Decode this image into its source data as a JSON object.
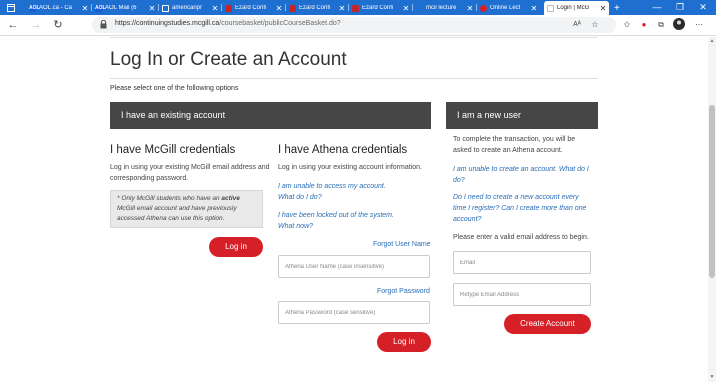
{
  "browser": {
    "tabs": [
      {
        "label": "AOL.ca - Ca",
        "fav_color": "#1d5bd6",
        "fav_text": "AOL"
      },
      {
        "label": "AOL Mail (6",
        "fav_color": "#1d5bd6",
        "fav_text": "AOL"
      },
      {
        "label": "americanpr",
        "fav_color": "#333333",
        "fav_text": ""
      },
      {
        "label": "Ezard Confi",
        "fav_color": "#c1272d",
        "fav_text": ""
      },
      {
        "label": "Ezard Confi",
        "fav_color": "#c1272d",
        "fav_text": ""
      },
      {
        "label": "Ezard Confi",
        "fav_color": "#c1272d",
        "fav_text": ""
      },
      {
        "label": "mcil lecture",
        "fav_color": "#1f6fd1",
        "fav_text": ""
      },
      {
        "label": "Online Lect",
        "fav_color": "#d62027",
        "fav_text": ""
      },
      {
        "label": "Login | McG",
        "fav_color": "#dddddd",
        "fav_text": ""
      }
    ],
    "new_tab": "+",
    "url_host": "https://continuingstudies.mcgill.ca",
    "url_path": "/coursebasket/publicCourseBasket.do?"
  },
  "page": {
    "title": "Log In or Create an Account",
    "subtitle": "Please select one of the following options",
    "existing_bar": "I have an existing account",
    "new_bar": "I am a new user",
    "mcgill": {
      "heading": "I have McGill credentials",
      "desc": "Log in using your existing McGill email address and corresponding password.",
      "note_pre": "* Only McGill students who have an ",
      "note_bold": "active",
      "note_post": " McGill email account and have previously accessed Athena can use this option.",
      "login_label": "Log in"
    },
    "athena": {
      "heading": "I have Athena credentials",
      "desc": "Log in using your existing account information.",
      "link_unable_1": "I am unable to access my account.",
      "link_unable_2": "What do I do?",
      "link_locked_1": "I have been locked out of the system.",
      "link_locked_2": "What now?",
      "forgot_user": "Forgot User Name",
      "username_placeholder": "Athena User Name (case insensitive)",
      "forgot_password": "Forgot Password",
      "password_placeholder": "Athena Password (case sensitive)",
      "login_label": "Log in"
    },
    "new_user": {
      "desc": "To complete the transaction, you will be asked to create an Athena account.",
      "link_create_1": "I am unable to create an account. What do I",
      "link_create_2": "do?",
      "link_new_1": "Do I need to create a new account every",
      "link_new_2": "time I register? Can I create more than one",
      "link_new_3": "account?",
      "email_prompt": "Please enter a valid email address to begin.",
      "email_placeholder": "Email",
      "retype_placeholder": "Retype Email Address",
      "create_label": "Create Account"
    }
  },
  "colors": {
    "brand_red": "#d62027",
    "dark_bar": "#464646",
    "link_blue": "#2a6eb7",
    "tabbar_blue": "#1f6fd1"
  }
}
